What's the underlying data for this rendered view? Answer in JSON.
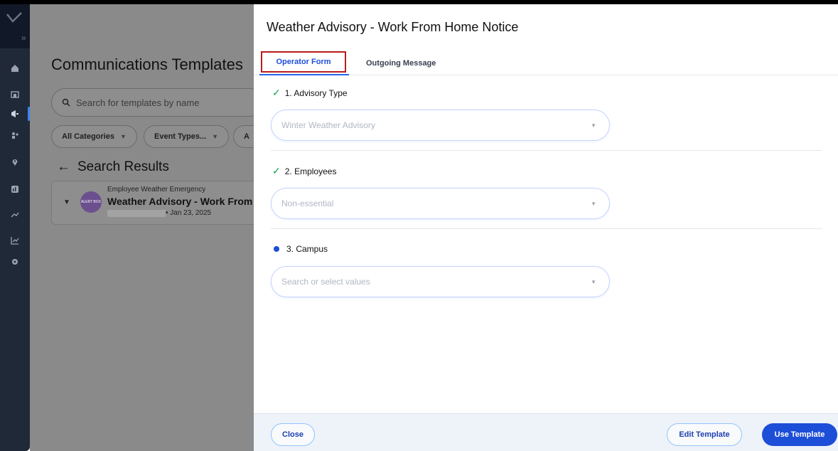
{
  "background": {
    "page_title": "Communications Templates",
    "search_placeholder": "Search for templates by name",
    "filters": [
      "All Categories",
      "Event Types...",
      "A"
    ],
    "results_heading": "Search Results",
    "result": {
      "category": "Employee Weather Emergency",
      "name": "Weather Advisory - Work From",
      "date": "• Jan 23, 2025",
      "avatar_text": "ALERT BOX"
    }
  },
  "nav": {
    "expand_glyph": "»",
    "icons": [
      "home-icon",
      "building-icon",
      "megaphone-icon",
      "people-icon",
      "location-pin-icon",
      "dashboard-icon",
      "routes-icon",
      "analytics-icon",
      "settings-icon"
    ]
  },
  "modal": {
    "title": "Weather Advisory - Work From Home Notice",
    "tabs": {
      "operator_form": "Operator Form",
      "outgoing_message": "Outgoing Message"
    },
    "sections": [
      {
        "label": "1. Advisory Type",
        "status": "complete",
        "value": "Winter Weather Advisory"
      },
      {
        "label": "2. Employees",
        "status": "complete",
        "value": "Non-essential"
      },
      {
        "label": "3. Campus",
        "status": "in-progress",
        "placeholder": "Search or select values"
      }
    ],
    "footer": {
      "close": "Close",
      "edit_template": "Edit Template",
      "use_template": "Use Template"
    }
  },
  "colors": {
    "accent": "#1d4ed8",
    "check": "#16a34a",
    "tab_highlight": "#b91c1c",
    "nav_bg": "#1f2937"
  }
}
